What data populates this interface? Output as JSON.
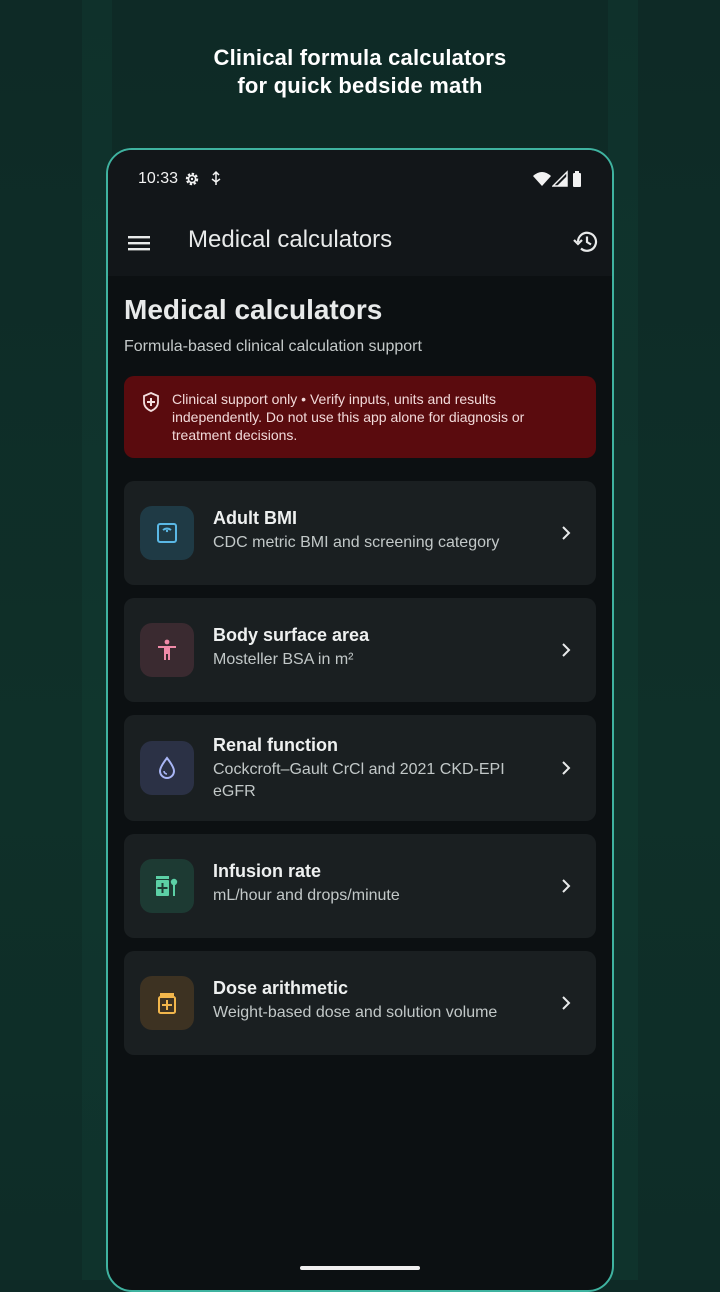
{
  "promo": {
    "headline_line1": "Clinical formula calculators",
    "headline_line2": "for quick bedside math"
  },
  "status_bar": {
    "time": "10:33"
  },
  "app_bar": {
    "title": "Medical calculators"
  },
  "page": {
    "title": "Medical calculators",
    "subtitle": "Formula-based clinical calculation support"
  },
  "warning": {
    "text": "Clinical support only • Verify inputs, units and results independently. Do not use this app alone for diagnosis or treatment decisions."
  },
  "calculators": [
    {
      "title": "Adult BMI",
      "description": "CDC metric BMI and screening category",
      "icon": "scale-icon",
      "color": "#5ab8e6",
      "bg": "#1f3a45"
    },
    {
      "title": "Body surface area",
      "description": "Mosteller BSA in m²",
      "icon": "person-icon",
      "color": "#f08aa8",
      "bg": "#3a2a30"
    },
    {
      "title": "Renal function",
      "description": "Cockcroft–Gault CrCl and 2021 CKD-EPI eGFR",
      "icon": "drop-icon",
      "color": "#a9b6f5",
      "bg": "#2b3145"
    },
    {
      "title": "Infusion rate",
      "description": "mL/hour and drops/minute",
      "icon": "infusion-icon",
      "color": "#5cd0a6",
      "bg": "#1d3a33"
    },
    {
      "title": "Dose arithmetic",
      "description": "Weight-based dose and solution volume",
      "icon": "medication-icon",
      "color": "#f2b64c",
      "bg": "#3d3222"
    }
  ],
  "colors": {
    "accent": "#3fb3a0",
    "warning_bg": "#5a0b0e",
    "card_bg": "#1a1f21"
  }
}
